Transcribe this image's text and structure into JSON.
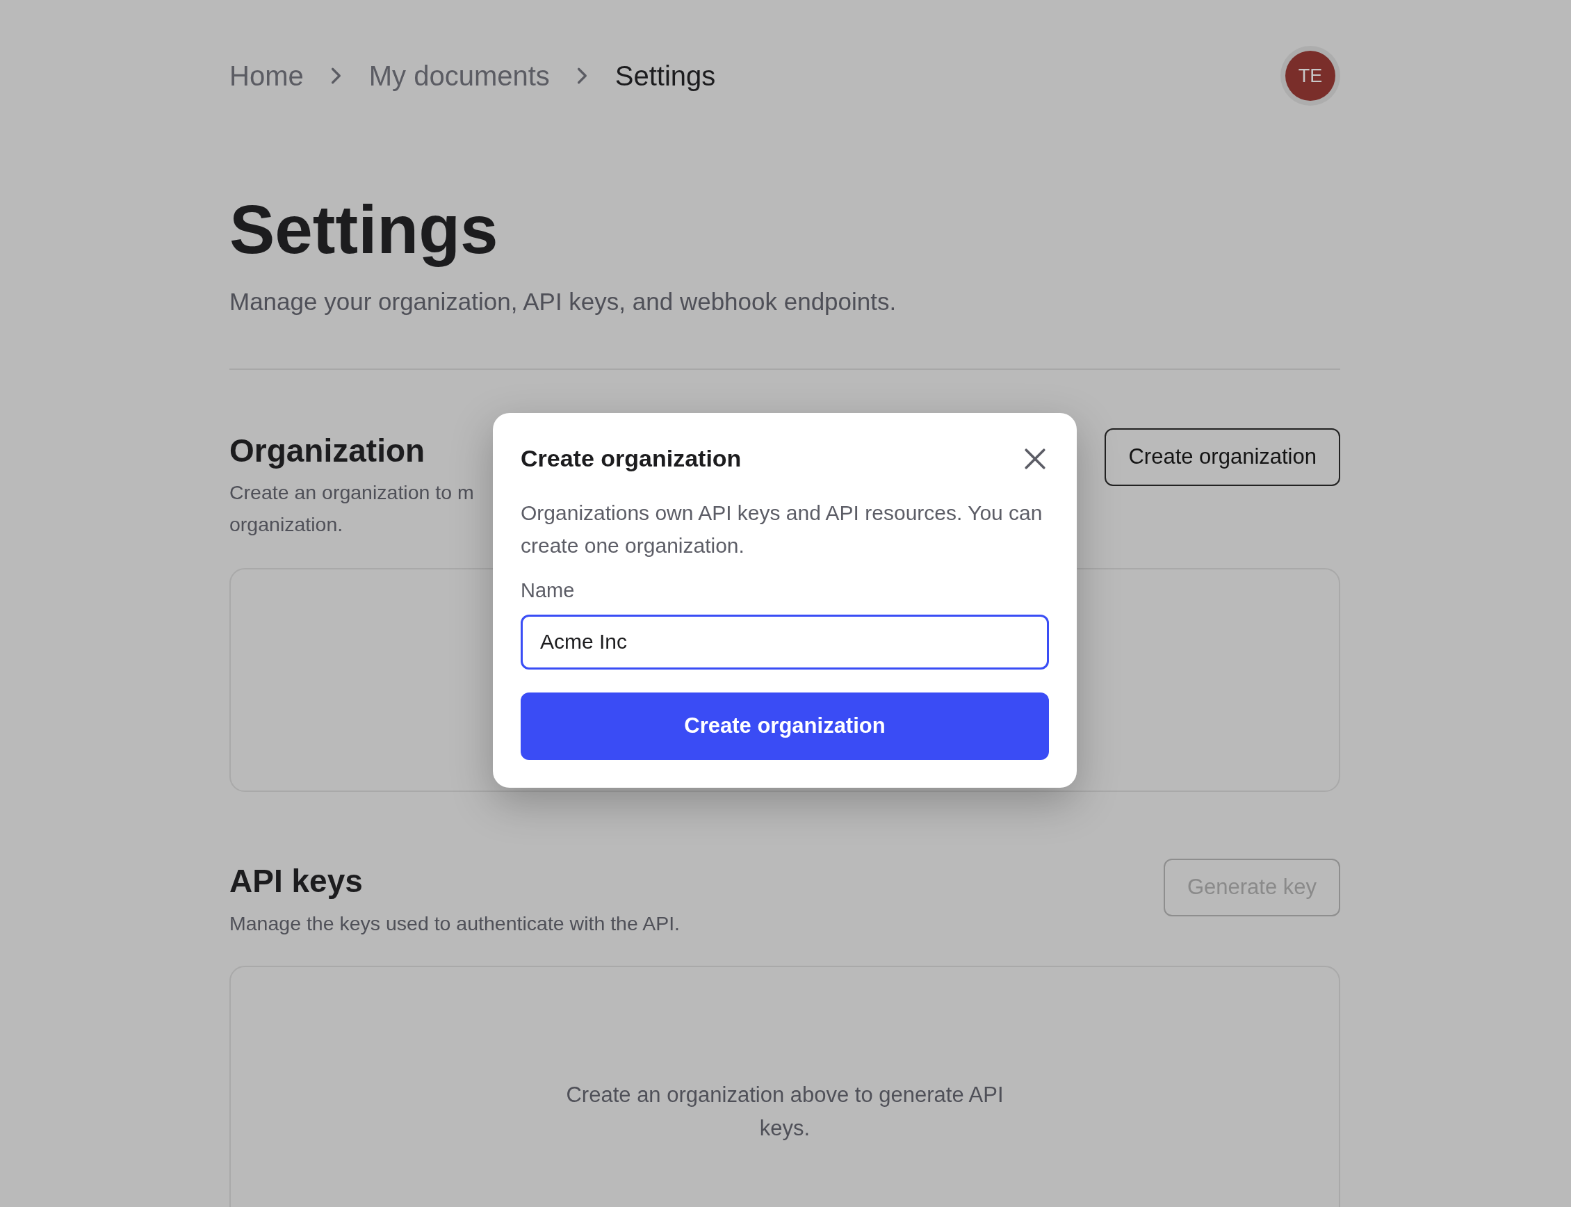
{
  "breadcrumb": [
    {
      "label": "Home",
      "current": false
    },
    {
      "label": "My documents",
      "current": false
    },
    {
      "label": "Settings",
      "current": true
    }
  ],
  "avatar": {
    "initials": "TE"
  },
  "page": {
    "title": "Settings",
    "subtitle": "Manage your organization, API keys, and webhook endpoints."
  },
  "sections": [
    {
      "title": "Organization",
      "description_lines": [
        "Create an organization to m",
        "organization."
      ],
      "action": {
        "label": "Create organization",
        "disabled": false
      }
    },
    {
      "title": "API keys",
      "description_lines": [
        "Manage the keys used to authenticate with the API."
      ],
      "action": {
        "label": "Generate key",
        "disabled": true
      },
      "empty_text": "Create an organization above to generate API keys."
    }
  ],
  "dialog": {
    "title": "Create organization",
    "description": "Organizations own API keys and API resources. You can create one organization.",
    "field": {
      "label": "Name",
      "value": "Acme Inc"
    },
    "submit": "Create organization"
  }
}
